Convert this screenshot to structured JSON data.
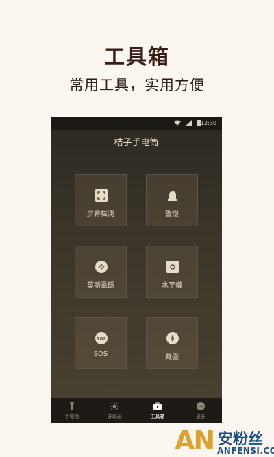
{
  "promo": {
    "title": "工具箱",
    "subtitle": "常用工具，实用方便"
  },
  "statusbar": {
    "time": "12:30",
    "icons": [
      "wifi-icon",
      "signal-icon",
      "battery-icon"
    ]
  },
  "app": {
    "title": "桔子手电筒"
  },
  "tools": [
    {
      "label": "屏幕檢測",
      "icon": "screen-frame-icon"
    },
    {
      "label": "警燈",
      "icon": "warning-light-icon"
    },
    {
      "label": "莫斯電碼",
      "icon": "morse-code-icon"
    },
    {
      "label": "水平儀",
      "icon": "level-icon"
    },
    {
      "label": "SOS",
      "icon": "sos-icon",
      "icon_text": "SOS"
    },
    {
      "label": "羅盤",
      "icon": "compass-icon"
    }
  ],
  "nav": [
    {
      "label": "手电筒",
      "icon": "flashlight-icon",
      "active": false
    },
    {
      "label": "屏幕光",
      "icon": "sun-icon",
      "active": false
    },
    {
      "label": "工具箱",
      "icon": "toolbox-icon",
      "active": true
    },
    {
      "label": "更多",
      "icon": "more-icon",
      "active": false
    }
  ],
  "watermark": {
    "logo": "AN",
    "name": "安粉丝",
    "domain": "ANFENSI.COM"
  },
  "colors": {
    "background": "#fbf6ef",
    "title": "#3b1d18",
    "tile_icon": "#e7dcc8",
    "watermark_orange": "#e0a12c",
    "watermark_blue": "#1e4d8a"
  }
}
